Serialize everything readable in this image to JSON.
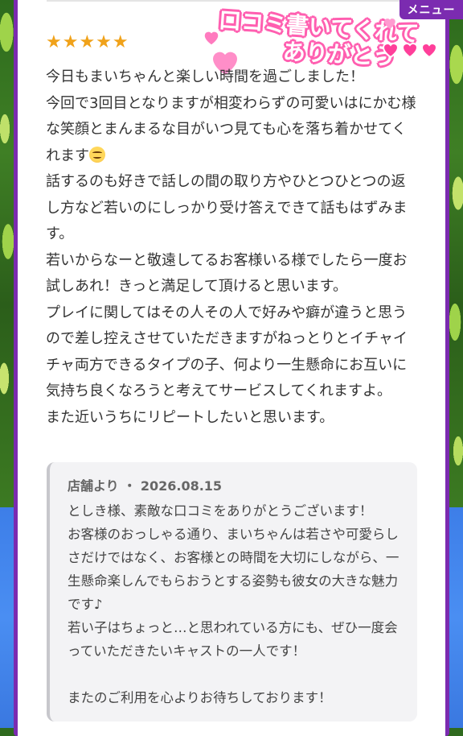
{
  "header": {
    "menu_label": "メニュー",
    "banner_line1": "口コミ書いてくれて",
    "banner_line2": "ありがとう"
  },
  "review": {
    "rating": 5,
    "stars": "★★★★★",
    "paragraphs": [
      "今日もまいちゃんと楽しい時間を過ごしました！",
      "今回で3回目となりますが相変わらずの可愛いはにかむ様な笑顔とまんまるな目がいつ見ても心を落ち着かせてくれます",
      "話するのも好きで話しの間の取り方やひとつひとつの返し方など若いのにしっかり受け答えできて話もはずみます。",
      "若いからなーと敬遠してるお客様いる様でしたら一度お試しあれ！きっと満足して頂けると思います。",
      "プレイに関してはその人その人で好みや癖が違うと思うので差し控えさせていただきますがねっとりとイチャイチャ両方できるタイプの子、何より一生懸命にお互いに気持ち良くなろうと考えてサービスしてくれますよ。",
      "また近いうちにリピートしたいと思います。"
    ]
  },
  "reply": {
    "source": "店舗より",
    "date": "2026.08.15",
    "lines": [
      "としき様、素敵な口コミをありがとうございます！",
      "お客様のおっしゃる通り、まいちゃんは若さや可愛らしさだけではなく、お客様との時間を大切にしながら、一生懸命楽しんでもらおうとする姿勢も彼女の大きな魅力です♪",
      "若い子はちょっと…と思われている方にも、ぜひ一度会っていただきたいキャストの一人です！",
      "",
      "またのご利用を心よりお待ちしております！"
    ]
  },
  "colors": {
    "frame": "#7b2bb0",
    "stars": "#f0a21a",
    "banner_outline": "#ff5fb0",
    "hearts": "#ff4fa0"
  }
}
